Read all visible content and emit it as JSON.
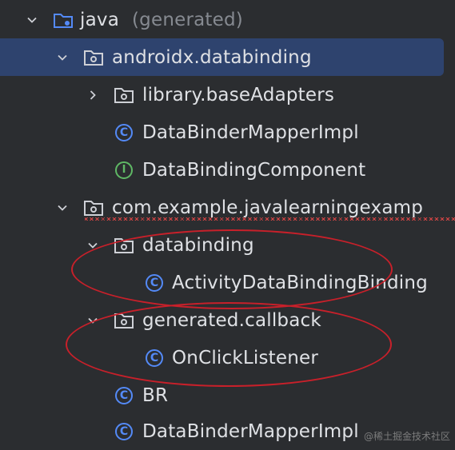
{
  "tree": {
    "root": {
      "label": "java",
      "suffix": "(generated)"
    },
    "pkg_androidx": {
      "label": "androidx.databinding"
    },
    "pkg_library": {
      "label": "library.baseAdapters"
    },
    "cls_mapper1": {
      "label": "DataBinderMapperImpl"
    },
    "iface_component": {
      "label": "DataBindingComponent"
    },
    "pkg_example": {
      "label": "com.example.javalearningexamp"
    },
    "pkg_databinding": {
      "label": "databinding"
    },
    "cls_activity": {
      "label": "ActivityDataBindingBinding"
    },
    "pkg_callback": {
      "label": "generated.callback"
    },
    "cls_onclick": {
      "label": "OnClickListener"
    },
    "cls_br": {
      "label": "BR"
    },
    "cls_mapper2": {
      "label": "DataBinderMapperImpl"
    }
  },
  "icons": {
    "class_letter": "C",
    "interface_letter": "I"
  },
  "colors": {
    "background": "#2b2d30",
    "selection": "#2e436e",
    "class_icon": "#548af7",
    "interface_icon": "#5fb865",
    "annotation": "#c8202a"
  },
  "watermark": "@稀土掘金技术社区"
}
